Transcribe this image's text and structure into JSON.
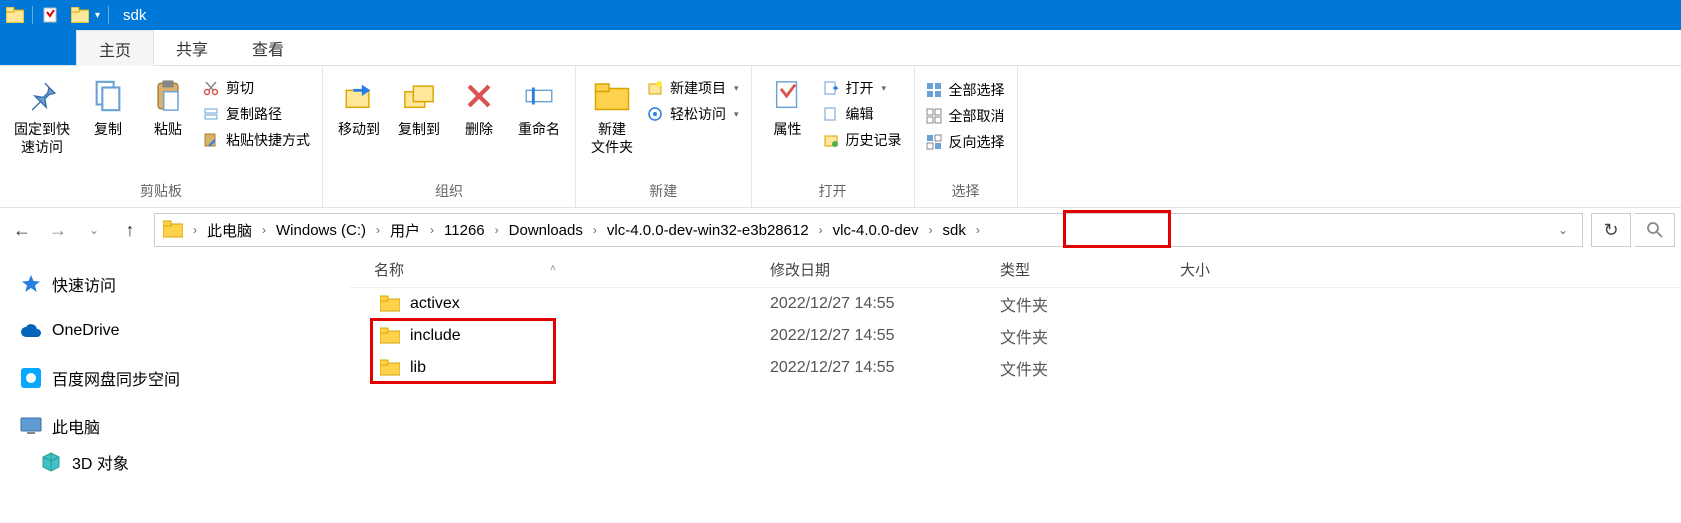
{
  "window": {
    "title": "sdk"
  },
  "tabs": {
    "home": "主页",
    "share": "共享",
    "view": "查看"
  },
  "ribbon": {
    "clipboard": {
      "label": "剪贴板",
      "pin": "固定到快\n速访问",
      "copy": "复制",
      "paste": "粘贴",
      "cut": "剪切",
      "copy_path": "复制路径",
      "paste_shortcut": "粘贴快捷方式"
    },
    "organize": {
      "label": "组织",
      "move_to": "移动到",
      "copy_to": "复制到",
      "delete": "删除",
      "rename": "重命名"
    },
    "new": {
      "label": "新建",
      "new_folder": "新建\n文件夹",
      "new_item": "新建项目",
      "easy_access": "轻松访问"
    },
    "open": {
      "label": "打开",
      "properties": "属性",
      "open": "打开",
      "edit": "编辑",
      "history": "历史记录"
    },
    "select": {
      "label": "选择",
      "select_all": "全部选择",
      "select_none": "全部取消",
      "invert": "反向选择"
    }
  },
  "breadcrumb": {
    "items": [
      "此电脑",
      "Windows (C:)",
      "用户",
      "11266",
      "Downloads",
      "vlc-4.0.0-dev-win32-e3b28612",
      "vlc-4.0.0-dev",
      "sdk"
    ]
  },
  "columns": {
    "name": "名称",
    "date": "修改日期",
    "type": "类型",
    "size": "大小"
  },
  "files": [
    {
      "name": "activex",
      "date": "2022/12/27 14:55",
      "type": "文件夹"
    },
    {
      "name": "include",
      "date": "2022/12/27 14:55",
      "type": "文件夹"
    },
    {
      "name": "lib",
      "date": "2022/12/27 14:55",
      "type": "文件夹"
    }
  ],
  "sidebar": {
    "quick_access": "快速访问",
    "onedrive": "OneDrive",
    "baidu": "百度网盘同步空间",
    "this_pc": "此电脑",
    "objects_3d": "3D 对象"
  }
}
